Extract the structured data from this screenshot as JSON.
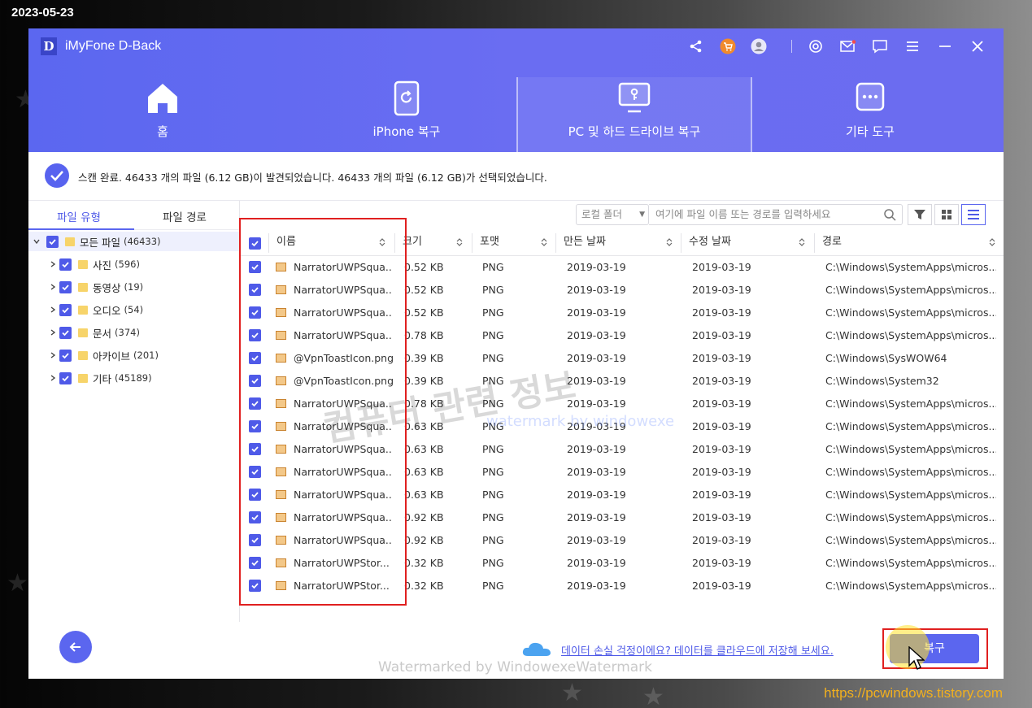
{
  "overlay": {
    "date": "2023-05-23",
    "site_url": "https://pcwindows.tistory.com",
    "watermark_korean": "컴퓨터 관련 정보",
    "watermark_english": "watermark by windowexe",
    "watermark_bottom": "Watermarked by WindowexeWatermark"
  },
  "app": {
    "logo_letter": "D",
    "title": "iMyFone D-Back"
  },
  "title_icons": [
    "share-icon",
    "cart-icon",
    "user-icon",
    "settings-icon",
    "mail-icon",
    "chat-icon",
    "menu-icon",
    "minimize-icon",
    "close-icon"
  ],
  "nav": {
    "tabs": [
      {
        "label": "홈",
        "icon": "home-icon",
        "active": false
      },
      {
        "label": "iPhone 복구",
        "icon": "iphone-recover-icon",
        "active": false
      },
      {
        "label": "PC 및 하드 드라이브 복구",
        "icon": "pc-recover-icon",
        "active": true
      },
      {
        "label": "기타 도구",
        "icon": "more-tools-icon",
        "active": false
      }
    ]
  },
  "status": {
    "text": "스캔 완료. 46433 개의 파일 (6.12 GB)이 발견되었습니다. 46433 개의 파일 (6.12 GB)가 선택되었습니다."
  },
  "left_panel": {
    "tabs": [
      "파일 유형",
      "파일 경로"
    ],
    "active_tab": "파일 유형",
    "tree": [
      {
        "name": "모든 파일",
        "count": "(46433)",
        "root": true
      },
      {
        "name": "사진",
        "count": "(596)"
      },
      {
        "name": "동영상",
        "count": "(19)"
      },
      {
        "name": "오디오",
        "count": "(54)"
      },
      {
        "name": "문서",
        "count": "(374)"
      },
      {
        "name": "아카이브",
        "count": "(201)"
      },
      {
        "name": "기타",
        "count": "(45189)"
      }
    ]
  },
  "toolbar": {
    "folder_select": "로컬 폴더",
    "search_placeholder": "여기에 파일 이름 또는 경로를 입력하세요"
  },
  "table": {
    "columns": [
      "이름",
      "크기",
      "포맷",
      "만든 날짜",
      "수정 날짜",
      "경로"
    ],
    "rows": [
      {
        "name": "NarratorUWPSqua...",
        "size": "0.52 KB",
        "format": "PNG",
        "created": "2019-03-19",
        "modified": "2019-03-19",
        "path": "C:\\Windows\\SystemApps\\micros..."
      },
      {
        "name": "NarratorUWPSqua...",
        "size": "0.52 KB",
        "format": "PNG",
        "created": "2019-03-19",
        "modified": "2019-03-19",
        "path": "C:\\Windows\\SystemApps\\micros..."
      },
      {
        "name": "NarratorUWPSqua...",
        "size": "0.52 KB",
        "format": "PNG",
        "created": "2019-03-19",
        "modified": "2019-03-19",
        "path": "C:\\Windows\\SystemApps\\micros..."
      },
      {
        "name": "NarratorUWPSqua...",
        "size": "0.78 KB",
        "format": "PNG",
        "created": "2019-03-19",
        "modified": "2019-03-19",
        "path": "C:\\Windows\\SystemApps\\micros..."
      },
      {
        "name": "@VpnToastIcon.png",
        "size": "0.39 KB",
        "format": "PNG",
        "created": "2019-03-19",
        "modified": "2019-03-19",
        "path": "C:\\Windows\\SysWOW64"
      },
      {
        "name": "@VpnToastIcon.png",
        "size": "0.39 KB",
        "format": "PNG",
        "created": "2019-03-19",
        "modified": "2019-03-19",
        "path": "C:\\Windows\\System32"
      },
      {
        "name": "NarratorUWPSqua...",
        "size": "0.78 KB",
        "format": "PNG",
        "created": "2019-03-19",
        "modified": "2019-03-19",
        "path": "C:\\Windows\\SystemApps\\micros..."
      },
      {
        "name": "NarratorUWPSqua...",
        "size": "0.63 KB",
        "format": "PNG",
        "created": "2019-03-19",
        "modified": "2019-03-19",
        "path": "C:\\Windows\\SystemApps\\micros..."
      },
      {
        "name": "NarratorUWPSqua...",
        "size": "0.63 KB",
        "format": "PNG",
        "created": "2019-03-19",
        "modified": "2019-03-19",
        "path": "C:\\Windows\\SystemApps\\micros..."
      },
      {
        "name": "NarratorUWPSqua...",
        "size": "0.63 KB",
        "format": "PNG",
        "created": "2019-03-19",
        "modified": "2019-03-19",
        "path": "C:\\Windows\\SystemApps\\micros..."
      },
      {
        "name": "NarratorUWPSqua...",
        "size": "0.63 KB",
        "format": "PNG",
        "created": "2019-03-19",
        "modified": "2019-03-19",
        "path": "C:\\Windows\\SystemApps\\micros..."
      },
      {
        "name": "NarratorUWPSqua...",
        "size": "0.92 KB",
        "format": "PNG",
        "created": "2019-03-19",
        "modified": "2019-03-19",
        "path": "C:\\Windows\\SystemApps\\micros..."
      },
      {
        "name": "NarratorUWPSqua...",
        "size": "0.92 KB",
        "format": "PNG",
        "created": "2019-03-19",
        "modified": "2019-03-19",
        "path": "C:\\Windows\\SystemApps\\micros..."
      },
      {
        "name": "NarratorUWPStor...",
        "size": "0.32 KB",
        "format": "PNG",
        "created": "2019-03-19",
        "modified": "2019-03-19",
        "path": "C:\\Windows\\SystemApps\\micros..."
      },
      {
        "name": "NarratorUWPStor...",
        "size": "0.32 KB",
        "format": "PNG",
        "created": "2019-03-19",
        "modified": "2019-03-19",
        "path": "C:\\Windows\\SystemApps\\micros..."
      }
    ]
  },
  "footer": {
    "cloud_link": "데이터 손실 걱정이에요? 데이터를 클라우드에 저장해 보세요.",
    "recover_button": "복구"
  },
  "colors": {
    "accent": "#5b66ef",
    "highlight_box": "#e02020",
    "url": "#f2b01e"
  }
}
